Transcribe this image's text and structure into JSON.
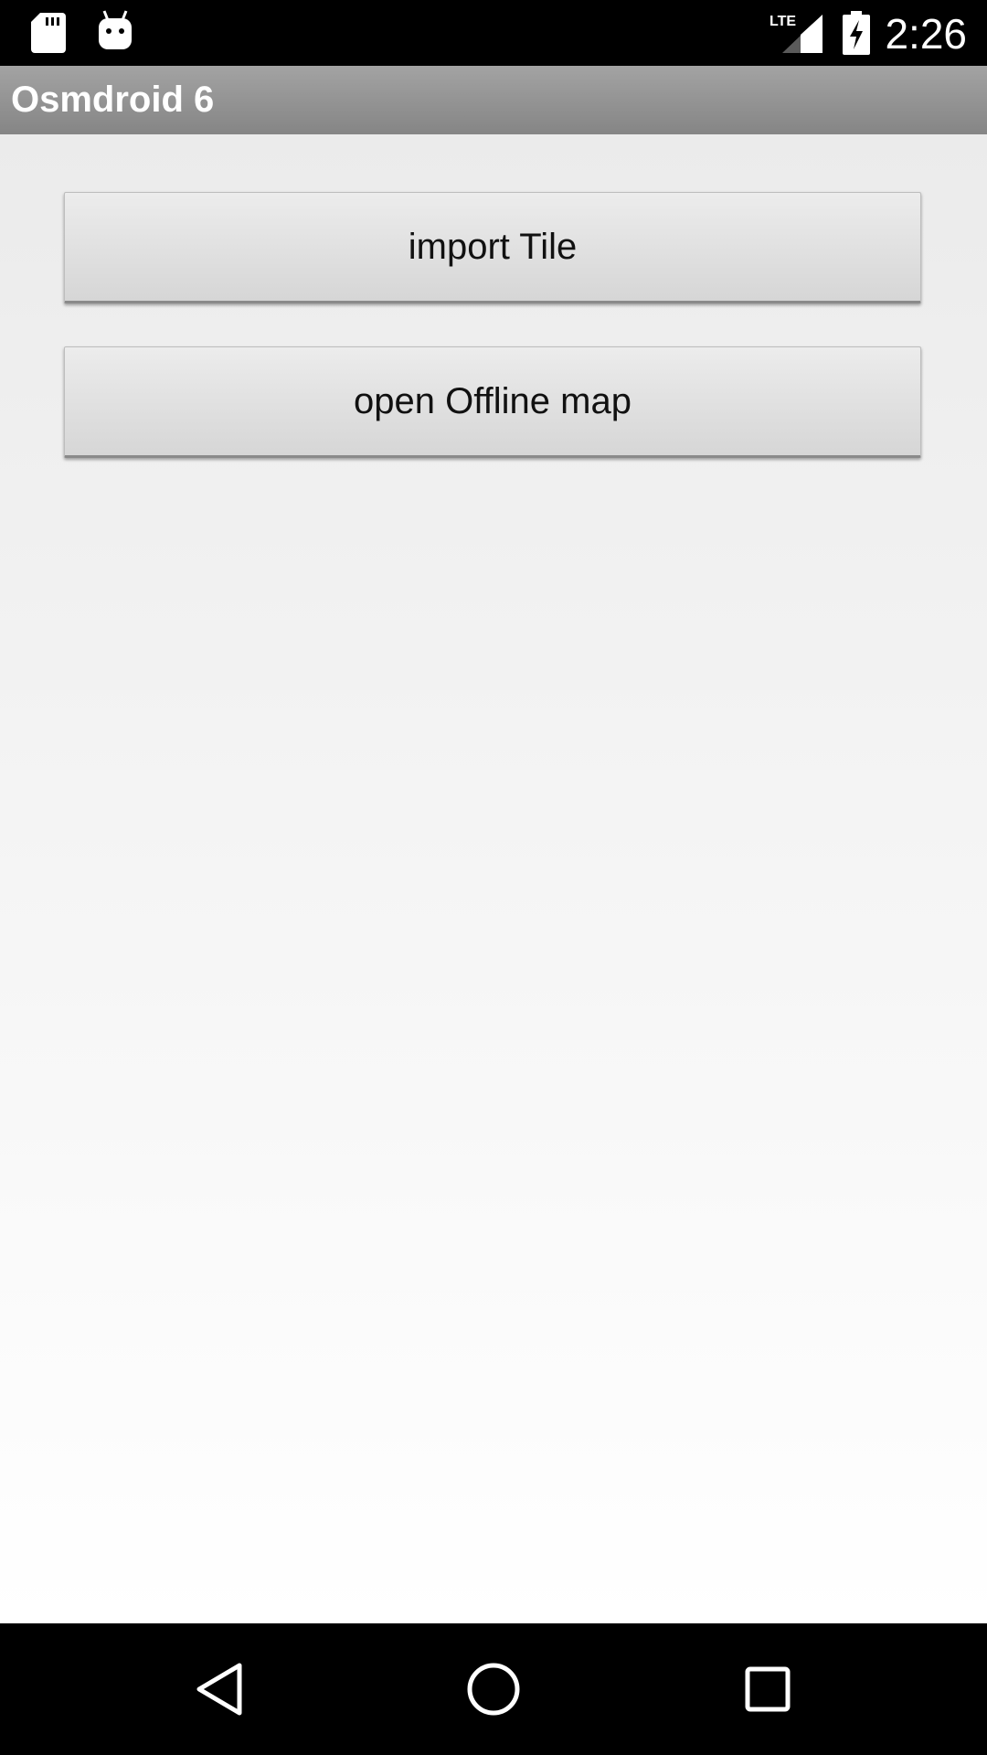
{
  "status_bar": {
    "time": "2:26",
    "network": "LTE",
    "icons": [
      "sd-card-icon",
      "android-icon",
      "lte-signal-icon",
      "battery-charging-icon"
    ]
  },
  "action_bar": {
    "title": "Osmdroid 6"
  },
  "main": {
    "buttons": [
      {
        "label": "import Tile"
      },
      {
        "label": "open Offline map"
      }
    ]
  },
  "nav_bar": {
    "icons": [
      "back-icon",
      "home-icon",
      "recents-icon"
    ]
  },
  "colors": {
    "status_bar_bg": "#000000",
    "action_bar_bg": "#939393",
    "content_bg_top": "#ebebeb",
    "content_bg_bottom": "#ffffff",
    "button_bg": "#e0e0e0",
    "nav_bar_bg": "#000000"
  }
}
